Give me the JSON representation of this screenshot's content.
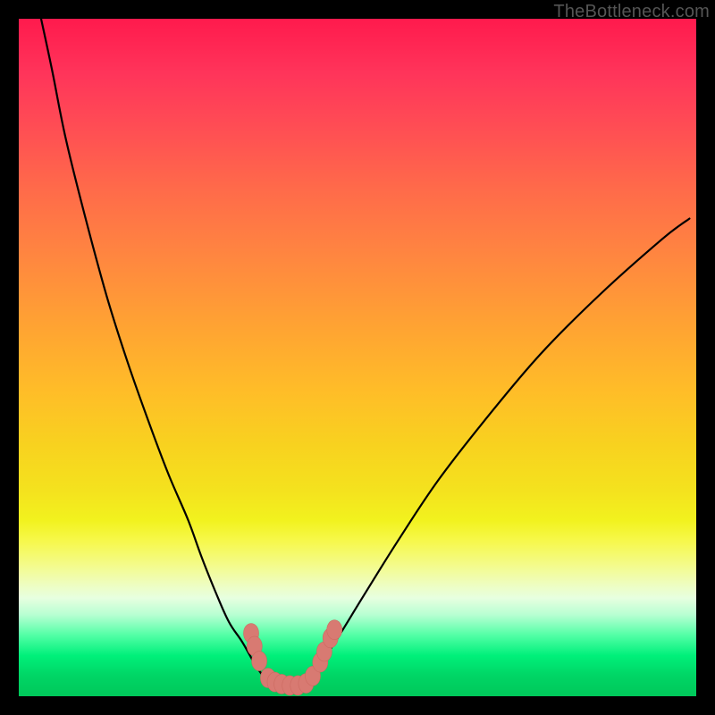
{
  "watermark": "TheBottleneck.com",
  "colors": {
    "page_bg": "#000000",
    "watermark": "#555555",
    "curve": "#000000",
    "dot_fill": "#d87a72",
    "dot_stroke": "#cc6a61"
  },
  "chart_data": {
    "type": "line",
    "title": "",
    "xlabel": "",
    "ylabel": "",
    "xlim": [
      0,
      100
    ],
    "ylim": [
      0,
      100
    ],
    "grid": false,
    "legend": false,
    "note": "Axes are not labeled; values are normalized 0–100 from pixel position. y=0 is green zone (best), y=100 is red (worst).",
    "series": [
      {
        "name": "left-curve",
        "x": [
          3.3,
          5,
          7,
          10,
          13,
          16,
          19,
          22,
          25,
          27,
          29,
          31,
          33,
          35,
          36.5,
          38
        ],
        "y": [
          100,
          92,
          82,
          70,
          59,
          49.5,
          41,
          33,
          26,
          20.5,
          15.5,
          11,
          8,
          4.5,
          2.5,
          1.5
        ]
      },
      {
        "name": "right-curve",
        "x": [
          42,
          44,
          47,
          51,
          56,
          62,
          69,
          77,
          86,
          95,
          99
        ],
        "y": [
          1.5,
          4,
          8.5,
          15,
          23,
          32,
          41,
          50.5,
          59.5,
          67.5,
          70.5
        ]
      }
    ],
    "points": [
      {
        "name": "cluster-dot",
        "x": 34.3,
        "y": 9.3
      },
      {
        "name": "cluster-dot",
        "x": 34.8,
        "y": 7.4
      },
      {
        "name": "cluster-dot",
        "x": 35.5,
        "y": 5.2
      },
      {
        "name": "cluster-dot",
        "x": 36.8,
        "y": 2.7
      },
      {
        "name": "cluster-dot",
        "x": 37.8,
        "y": 2.1
      },
      {
        "name": "cluster-dot",
        "x": 38.8,
        "y": 1.8
      },
      {
        "name": "cluster-dot",
        "x": 40.0,
        "y": 1.6
      },
      {
        "name": "cluster-dot",
        "x": 41.2,
        "y": 1.6
      },
      {
        "name": "cluster-dot",
        "x": 42.4,
        "y": 1.9
      },
      {
        "name": "cluster-dot",
        "x": 43.4,
        "y": 3.0
      },
      {
        "name": "cluster-dot",
        "x": 44.5,
        "y": 5.0
      },
      {
        "name": "cluster-dot",
        "x": 45.1,
        "y": 6.6
      },
      {
        "name": "cluster-dot",
        "x": 46.0,
        "y": 8.6
      },
      {
        "name": "cluster-dot",
        "x": 46.6,
        "y": 9.8
      }
    ]
  }
}
